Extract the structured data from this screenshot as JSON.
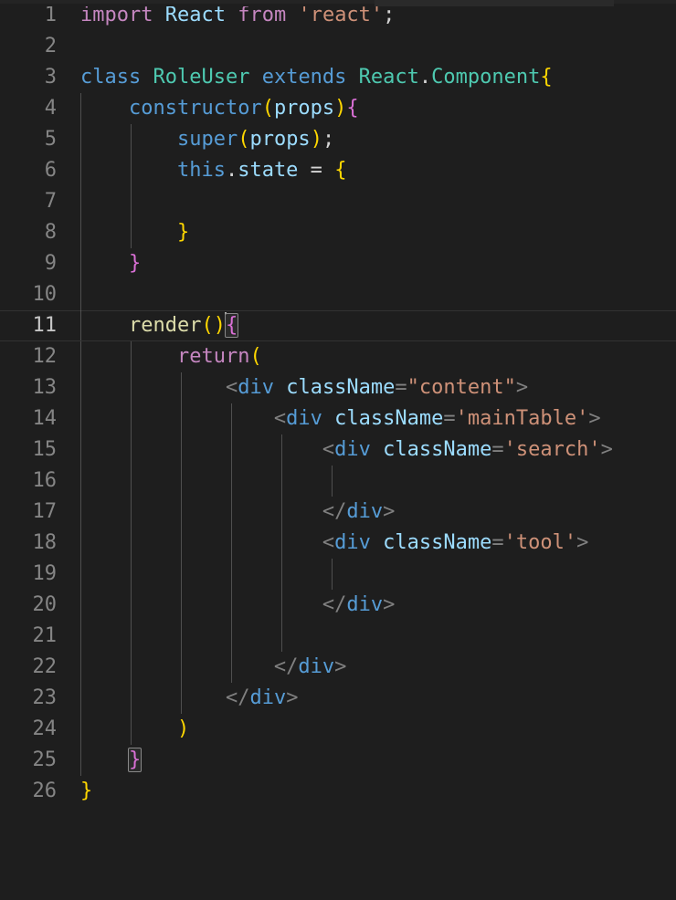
{
  "editor": {
    "name": "code-editor",
    "language": "javascript-react",
    "theme": "dark-plus",
    "background": "#1e1e1e",
    "gutter_color": "#858585",
    "active_line": 11,
    "indent_size": 4,
    "colors": {
      "keyword": "#569cd6",
      "control": "#c586c0",
      "type": "#4ec9b0",
      "variable": "#9cdcfe",
      "string": "#ce9178",
      "function": "#dcdcaa",
      "plain": "#d4d4d4",
      "tag_punct": "#808080",
      "bracket1": "#ffd700",
      "bracket2": "#da70d6",
      "bracket3": "#179fff",
      "active_line_border": "#323232",
      "bracket_match_border": "#888888"
    },
    "line_numbers": [
      1,
      2,
      3,
      4,
      5,
      6,
      7,
      8,
      9,
      10,
      11,
      12,
      13,
      14,
      15,
      16,
      17,
      18,
      19,
      20,
      21,
      22,
      23,
      24,
      25,
      26
    ],
    "code_text": [
      "import React from 'react';",
      "",
      "class RoleUser extends React.Component{",
      "    constructor(props){",
      "        super(props);",
      "        this.state = {",
      "",
      "        }",
      "    }",
      "",
      "    render(){",
      "        return(",
      "            <div className=\"content\">",
      "                <div className='mainTable'>",
      "                    <div className='search'>",
      "",
      "                    </div>",
      "                    <div className='tool'>",
      "",
      "                    </div>",
      "",
      "                </div>",
      "            </div>",
      "        )",
      "    }",
      "}"
    ]
  }
}
